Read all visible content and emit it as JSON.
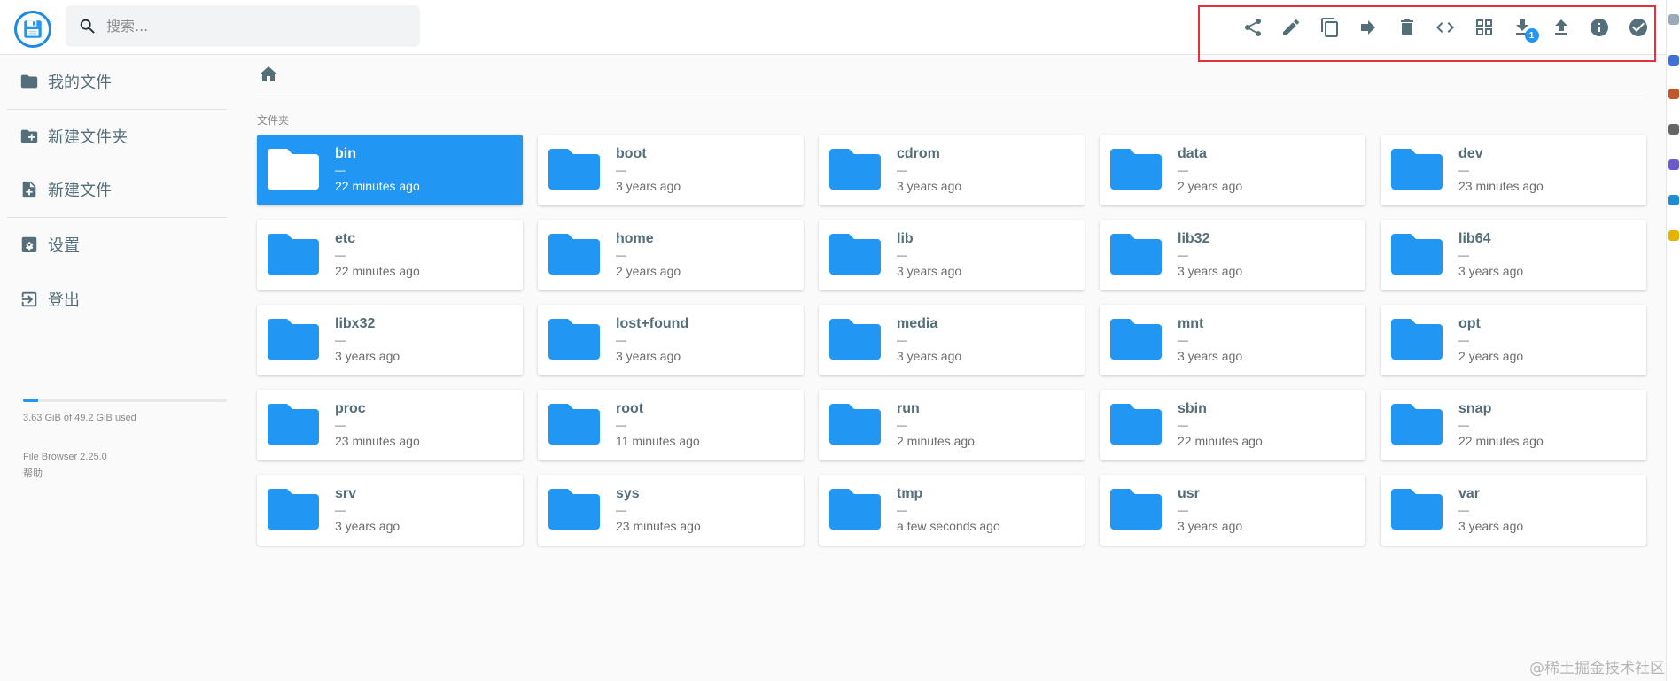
{
  "header": {
    "search_placeholder": "搜索...",
    "download_badge": "1",
    "toolbar": [
      {
        "name": "share-icon"
      },
      {
        "name": "rename-icon"
      },
      {
        "name": "copy-icon"
      },
      {
        "name": "move-icon"
      },
      {
        "name": "delete-icon"
      },
      {
        "name": "code-icon"
      },
      {
        "name": "grid-view-icon"
      },
      {
        "name": "download-icon"
      },
      {
        "name": "upload-icon"
      },
      {
        "name": "info-icon"
      },
      {
        "name": "select-all-icon"
      }
    ],
    "colors": {
      "accent": "#2196f3",
      "highlight_border": "#e2323d"
    }
  },
  "sidebar": {
    "items": [
      {
        "label": "我的文件",
        "icon": "folder-icon"
      },
      {
        "label": "新建文件夹",
        "icon": "new-folder-icon"
      },
      {
        "label": "新建文件",
        "icon": "new-file-icon"
      },
      {
        "label": "设置",
        "icon": "settings-icon"
      },
      {
        "label": "登出",
        "icon": "logout-icon"
      }
    ],
    "usage": {
      "text": "3.63 GiB of 49.2 GiB used",
      "fraction": 0.074
    },
    "version": "File Browser 2.25.0",
    "help": "帮助"
  },
  "main": {
    "section_title": "文件夹",
    "folders": [
      {
        "name": "bin",
        "size": "—",
        "modified": "22 minutes ago",
        "selected": true
      },
      {
        "name": "boot",
        "size": "—",
        "modified": "3 years ago"
      },
      {
        "name": "cdrom",
        "size": "—",
        "modified": "3 years ago"
      },
      {
        "name": "data",
        "size": "—",
        "modified": "2 years ago"
      },
      {
        "name": "dev",
        "size": "—",
        "modified": "23 minutes ago"
      },
      {
        "name": "etc",
        "size": "—",
        "modified": "22 minutes ago"
      },
      {
        "name": "home",
        "size": "—",
        "modified": "2 years ago"
      },
      {
        "name": "lib",
        "size": "—",
        "modified": "3 years ago"
      },
      {
        "name": "lib32",
        "size": "—",
        "modified": "3 years ago"
      },
      {
        "name": "lib64",
        "size": "—",
        "modified": "3 years ago"
      },
      {
        "name": "libx32",
        "size": "—",
        "modified": "3 years ago"
      },
      {
        "name": "lost+found",
        "size": "—",
        "modified": "3 years ago"
      },
      {
        "name": "media",
        "size": "—",
        "modified": "3 years ago"
      },
      {
        "name": "mnt",
        "size": "—",
        "modified": "3 years ago"
      },
      {
        "name": "opt",
        "size": "—",
        "modified": "2 years ago"
      },
      {
        "name": "proc",
        "size": "—",
        "modified": "23 minutes ago"
      },
      {
        "name": "root",
        "size": "—",
        "modified": "11 minutes ago"
      },
      {
        "name": "run",
        "size": "—",
        "modified": "2 minutes ago"
      },
      {
        "name": "sbin",
        "size": "—",
        "modified": "22 minutes ago"
      },
      {
        "name": "snap",
        "size": "—",
        "modified": "22 minutes ago"
      },
      {
        "name": "srv",
        "size": "—",
        "modified": "3 years ago"
      },
      {
        "name": "sys",
        "size": "—",
        "modified": "23 minutes ago"
      },
      {
        "name": "tmp",
        "size": "—",
        "modified": "a few seconds ago"
      },
      {
        "name": "usr",
        "size": "—",
        "modified": "3 years ago"
      },
      {
        "name": "var",
        "size": "—",
        "modified": "3 years ago"
      }
    ]
  },
  "watermark": "@稀土掘金技术社区"
}
